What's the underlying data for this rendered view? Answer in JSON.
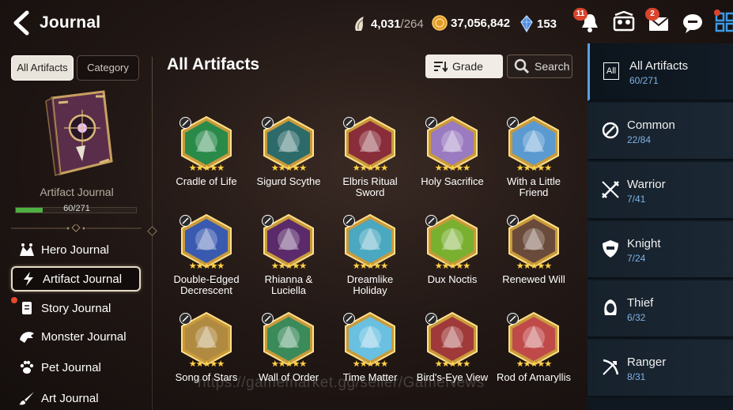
{
  "header": {
    "title": "Journal",
    "stamina": {
      "value": "4,031",
      "max": "/264"
    },
    "gold": "37,056,842",
    "crystals": "153",
    "notifications_badge": "11",
    "mail_badge": "2"
  },
  "left": {
    "tabs": [
      "All Artifacts",
      "Category"
    ],
    "book_label": "Artifact Journal",
    "progress_text": "60/271",
    "progress_fraction": 0.221,
    "menu": [
      {
        "label": "Hero Journal",
        "icon": "hero-icon"
      },
      {
        "label": "Artifact Journal",
        "icon": "lightning-icon",
        "selected": true
      },
      {
        "label": "Story Journal",
        "icon": "scroll-icon",
        "dot": true
      },
      {
        "label": "Monster Journal",
        "icon": "monster-icon"
      },
      {
        "label": "Pet Journal",
        "icon": "paw-icon"
      },
      {
        "label": "Art Journal",
        "icon": "brush-icon"
      }
    ]
  },
  "main": {
    "title": "All Artifacts",
    "grade_label": "Grade",
    "search_label": "Search",
    "artifacts": [
      {
        "name": "Cradle of Life",
        "stars": "★★★★★",
        "color": "#2a8a4a",
        "type": "warrior"
      },
      {
        "name": "Sigurd Scythe",
        "stars": "★★★★★",
        "color": "#2d6b6a",
        "type": "warrior"
      },
      {
        "name": "Elbris Ritual Sword",
        "stars": "★★★★★",
        "color": "#8a2d3a",
        "type": "knight"
      },
      {
        "name": "Holy Sacrifice",
        "stars": "★★★★★",
        "color": "#9a7ac0",
        "type": "knight"
      },
      {
        "name": "With a Little Friend",
        "stars": "★★★★★",
        "color": "#5a9ad0",
        "type": "knight"
      },
      {
        "name": "Double-Edged Decrescent",
        "stars": "★★★★★",
        "color": "#3a5ab0",
        "type": "thief"
      },
      {
        "name": "Rhianna & Luciella",
        "stars": "★★★★★",
        "color": "#5a2a6a",
        "type": "thief"
      },
      {
        "name": "Dreamlike Holiday",
        "stars": "★★★★★",
        "color": "#4aa8c0",
        "type": "ranger"
      },
      {
        "name": "Dux Noctis",
        "stars": "★★★★★",
        "color": "#7ab030",
        "type": "ranger"
      },
      {
        "name": "Renewed Will",
        "stars": "★★★★★",
        "color": "#6a4a3a",
        "type": "ranger"
      },
      {
        "name": "Song of Stars",
        "stars": "★★★★★",
        "color": "#b08a40",
        "type": "ranger"
      },
      {
        "name": "Wall of Order",
        "stars": "★★★★★",
        "color": "#3a8a5a",
        "type": "ranger"
      },
      {
        "name": "Time Matter",
        "stars": "★★★★★",
        "color": "#6ac0e0",
        "type": "mage"
      },
      {
        "name": "Bird's-Eye View",
        "stars": "★★★★★",
        "color": "#a03a3a",
        "type": "ranger"
      },
      {
        "name": "Rod of Amaryllis",
        "stars": "★★★★★",
        "color": "#c04a4a",
        "type": "mage"
      }
    ]
  },
  "right": {
    "categories": [
      {
        "name": "All Artifacts",
        "count": "60/271",
        "icon": "all-icon",
        "all_label": "All"
      },
      {
        "name": "Common",
        "count": "22/84",
        "icon": "common-icon"
      },
      {
        "name": "Warrior",
        "count": "7/41",
        "icon": "warrior-icon"
      },
      {
        "name": "Knight",
        "count": "7/24",
        "icon": "knight-icon"
      },
      {
        "name": "Thief",
        "count": "6/32",
        "icon": "thief-icon"
      },
      {
        "name": "Ranger",
        "count": "8/31",
        "icon": "ranger-icon"
      }
    ]
  },
  "watermark": "https://gamemarket.gg/seller/GameNews"
}
